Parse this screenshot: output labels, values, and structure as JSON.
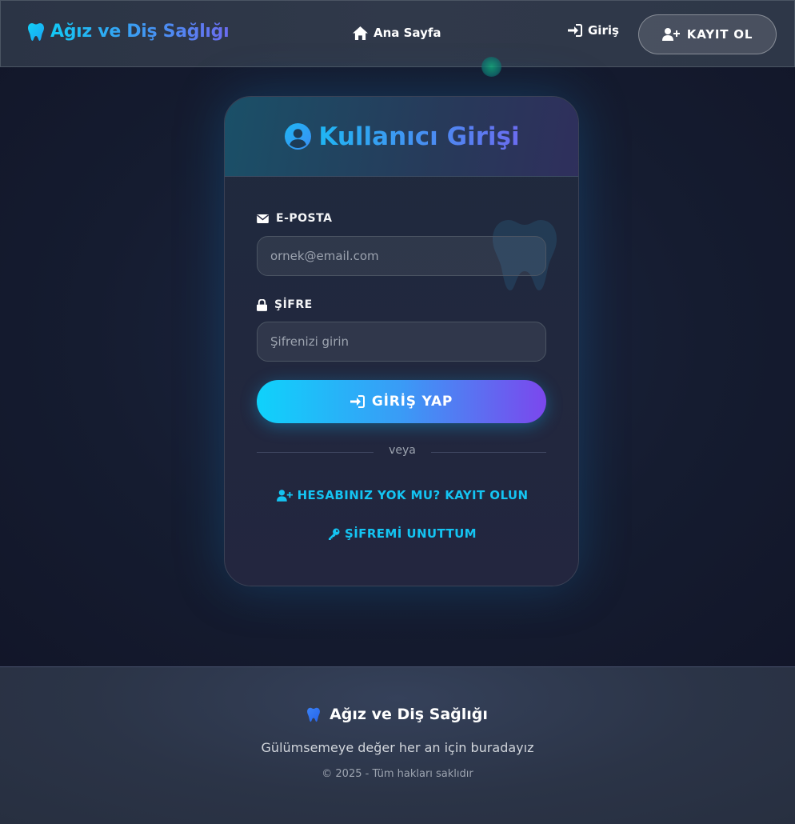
{
  "navbar": {
    "brand": "Ağız ve Diş Sağlığı",
    "brand_icon": "tooth-icon",
    "home_label": "Ana Sayfa",
    "login_label": "Giriş",
    "register_label": "KAYIT OL"
  },
  "login_card": {
    "title": "Kullanıcı Girişi",
    "email": {
      "label": "E-POSTA",
      "placeholder": "ornek@email.com",
      "value": ""
    },
    "password": {
      "label": "ŞİFRE",
      "placeholder": "Şifrenizi girin",
      "value": ""
    },
    "submit_label": "GİRİŞ YAP",
    "divider_text": "veya",
    "register_link": "HESABINIZ YOK MU? KAYIT OLUN",
    "forgot_link": "ŞİFREMİ UNUTTUM"
  },
  "footer": {
    "brand": "Ağız ve Diş Sağlığı",
    "slogan": "Gülümsemeye değer her an için buradayız",
    "copyright": "© 2025 - Tüm hakları saklıdır"
  },
  "colors": {
    "accent_cyan": "#12c8f5",
    "accent_purple": "#7b47ed",
    "background": "#151c30",
    "link": "#14c4f2"
  }
}
